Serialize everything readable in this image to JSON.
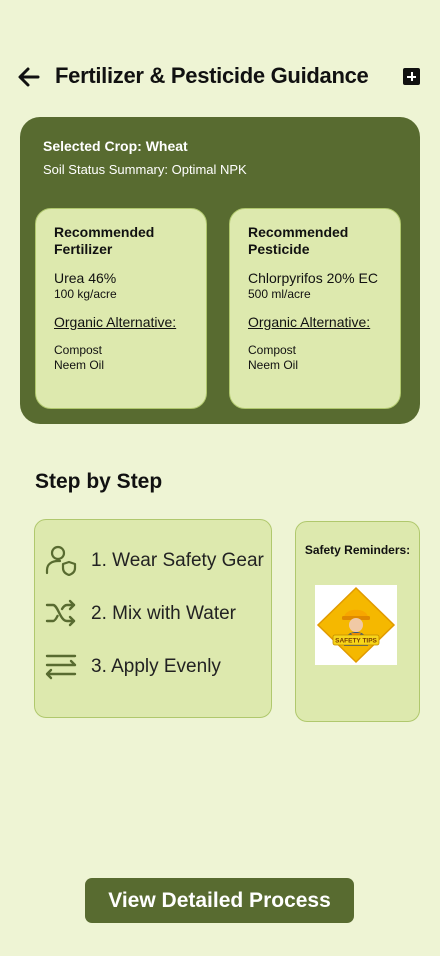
{
  "header": {
    "title": "Fertilizer & Pesticide Guidance",
    "back_icon": "arrow-left-icon",
    "action_icon": "plus-square-icon"
  },
  "crop": {
    "selected": "Selected Crop: Wheat",
    "soil_status": "Soil Status Summary: Optimal NPK",
    "fertilizer": {
      "heading": "Recommended Fertilizer",
      "product": "Urea 46%",
      "rate": "100 kg/acre",
      "organic_label": "Organic Alternative:",
      "alternatives": [
        "Compost",
        "Neem Oil"
      ]
    },
    "pesticide": {
      "heading": "Recommended Pesticide",
      "product": "Chlorpyrifos 20% EC",
      "rate": "500 ml/acre",
      "organic_label": "Organic Alternative:",
      "alternatives": [
        "Compost",
        "Neem Oil"
      ]
    }
  },
  "steps": {
    "heading": "Step by Step",
    "items": [
      {
        "label": "1. Wear Safety Gear",
        "icon": "user-shield-icon"
      },
      {
        "label": "2. Mix with Water",
        "icon": "shuffle-icon"
      },
      {
        "label": "3. Apply Evenly",
        "icon": "arrows-exchange-icon"
      }
    ]
  },
  "safety": {
    "title": "Safety Reminders:",
    "badge_text": "SAFETY TIPS"
  },
  "cta": {
    "label": "View Detailed Process"
  },
  "colors": {
    "background": "#eef4d4",
    "primary": "#586b30",
    "card": "#dde9ae",
    "card_border": "#b0c86d",
    "badge": "#f5b800"
  }
}
